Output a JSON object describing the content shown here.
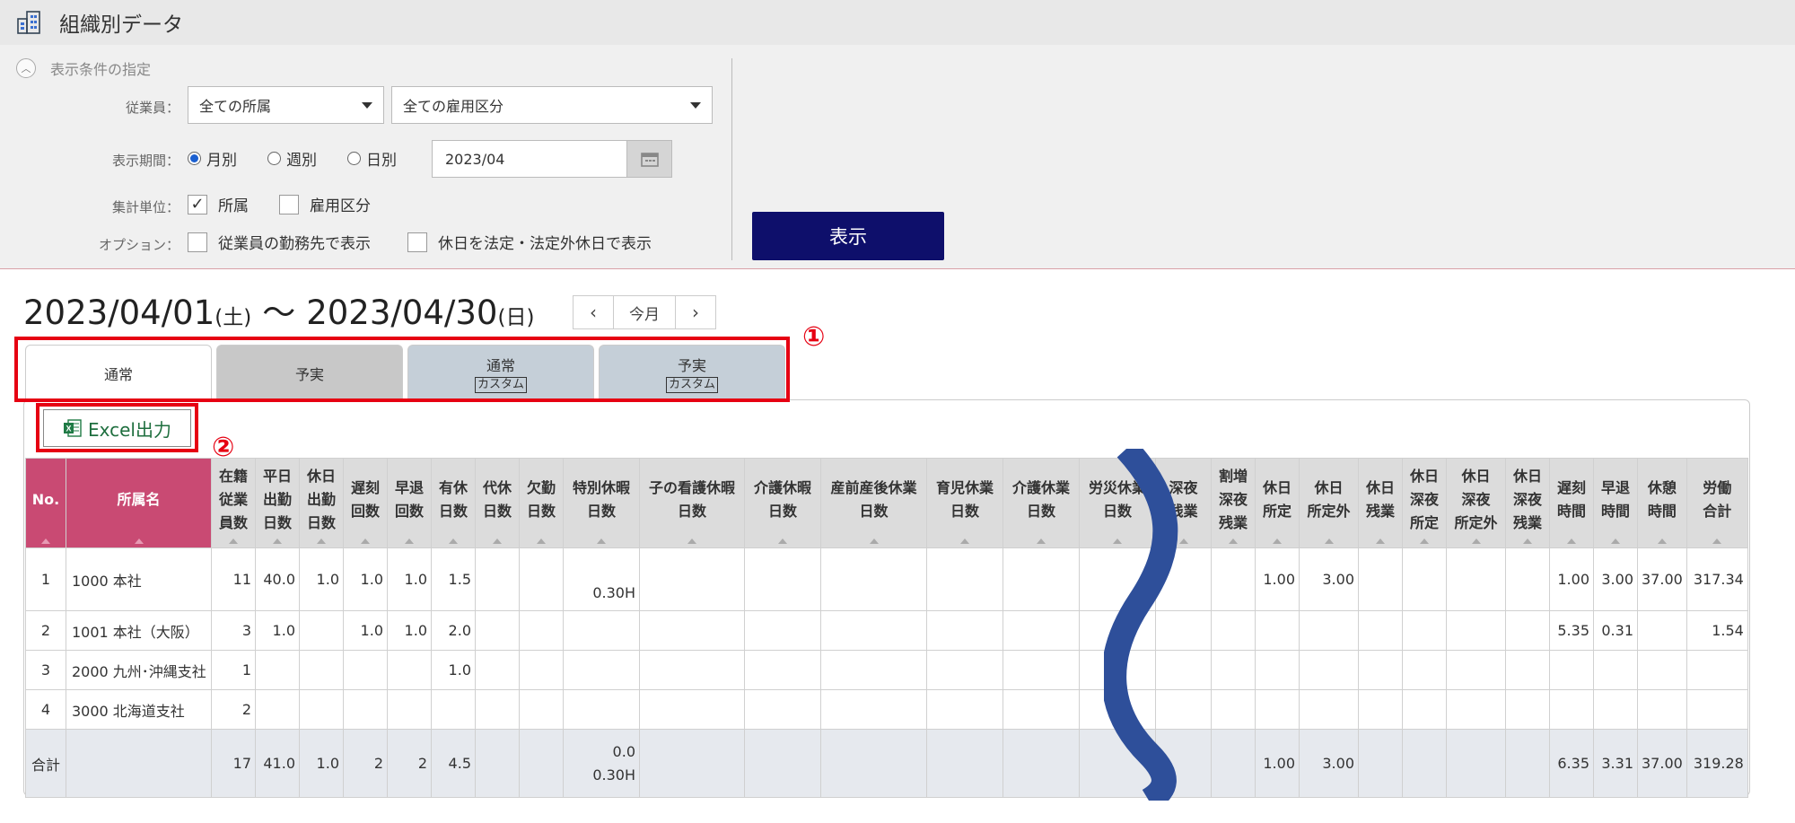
{
  "title": "組織別データ",
  "filter": {
    "collapse_label": "表示条件の指定",
    "employee_label": "従業員：",
    "dept_select": "全ての所属",
    "emp_type_select": "全ての雇用区分",
    "period_label": "表示期間：",
    "period_options": [
      "月別",
      "週別",
      "日別"
    ],
    "period_selected": "月別",
    "date_value": "2023/04",
    "unit_label": "集計単位：",
    "unit_dept": "所属",
    "unit_emp_type": "雇用区分",
    "option_label": "オプション：",
    "option_workplace": "従業員の勤務先で表示",
    "option_holiday": "休日を法定・法定外休日で表示",
    "show_button": "表示"
  },
  "range": {
    "start": "2023/04/01",
    "start_dow": "(土)",
    "tilde": "〜",
    "end": "2023/04/30",
    "end_dow": "(日)",
    "today": "今月"
  },
  "tabs": [
    {
      "label": "通常",
      "sub": ""
    },
    {
      "label": "予実",
      "sub": ""
    },
    {
      "label": "通常",
      "sub": "カスタム"
    },
    {
      "label": "予実",
      "sub": "カスタム"
    }
  ],
  "markers": [
    "①",
    "②"
  ],
  "excel_label": "Excel出力",
  "table": {
    "headers": [
      [
        "No."
      ],
      [
        "所属名"
      ],
      [
        "在籍",
        "従業",
        "員数"
      ],
      [
        "平日",
        "出勤",
        "日数"
      ],
      [
        "休日",
        "出勤",
        "日数"
      ],
      [
        "遅刻",
        "回数"
      ],
      [
        "早退",
        "回数"
      ],
      [
        "有休",
        "日数"
      ],
      [
        "代休",
        "日数"
      ],
      [
        "欠勤",
        "日数"
      ],
      [
        "特別休暇",
        "日数"
      ],
      [
        "子の看護休暇",
        "日数"
      ],
      [
        "介護休暇",
        "日数"
      ],
      [
        "産前産後休業",
        "日数"
      ],
      [
        "育児休業",
        "日数"
      ],
      [
        "介護休業",
        "日数"
      ],
      [
        "労災休業",
        "日数"
      ],
      [
        "深夜",
        "残業"
      ],
      [
        "割増",
        "深夜",
        "残業"
      ],
      [
        "休日",
        "所定"
      ],
      [
        "休日",
        "所定外"
      ],
      [
        "休日",
        "残業"
      ],
      [
        "休日",
        "深夜",
        "所定"
      ],
      [
        "休日",
        "深夜",
        "所定外"
      ],
      [
        "休日",
        "深夜",
        "残業"
      ],
      [
        "遅刻",
        "時間"
      ],
      [
        "早退",
        "時間"
      ],
      [
        "休憩",
        "時間"
      ],
      [
        "労働",
        "合計"
      ]
    ],
    "rows": [
      [
        "1",
        "1000 本社",
        "11",
        "40.0",
        "1.0",
        "1.0",
        "1.0",
        "1.5",
        "",
        "",
        "0.30H",
        "",
        "",
        "",
        "",
        "",
        "",
        "",
        "",
        "1.00",
        "3.00",
        "",
        "",
        "",
        "",
        "1.00",
        "3.00",
        "37.00",
        "317.34"
      ],
      [
        "2",
        "1001 本社（大阪）",
        "3",
        "1.0",
        "",
        "1.0",
        "1.0",
        "2.0",
        "",
        "",
        "",
        "",
        "",
        "",
        "",
        "",
        "",
        "",
        "",
        "",
        "",
        "",
        "",
        "",
        "",
        "5.35",
        "0.31",
        "",
        "1.54"
      ],
      [
        "3",
        "2000 九州･沖縄支社",
        "1",
        "",
        "",
        "",
        "",
        "1.0",
        "",
        "",
        "",
        "",
        "",
        "",
        "",
        "",
        "",
        "",
        "",
        "",
        "",
        "",
        "",
        "",
        "",
        "",
        "",
        "",
        ""
      ],
      [
        "4",
        "3000 北海道支社",
        "2",
        "",
        "",
        "",
        "",
        "",
        "",
        "",
        "",
        "",
        "",
        "",
        "",
        "",
        "",
        "",
        "",
        "",
        "",
        "",
        "",
        "",
        "",
        "",
        "",
        "",
        ""
      ]
    ],
    "total_label": "合計",
    "total": [
      "",
      "17",
      "41.0",
      "1.0",
      "2",
      "2",
      "4.5",
      "",
      "",
      "0.0|0.30H",
      "",
      "",
      "",
      "",
      "",
      "",
      "",
      "",
      "1.00",
      "3.00",
      "",
      "",
      "",
      "",
      "6.35",
      "3.31",
      "37.00",
      "319.28"
    ]
  },
  "colors": {
    "accent_pink": "#c94a73",
    "show_button": "#0e0f6b",
    "highlight_red": "#e60012",
    "wave_blue": "#2e4f9a"
  }
}
